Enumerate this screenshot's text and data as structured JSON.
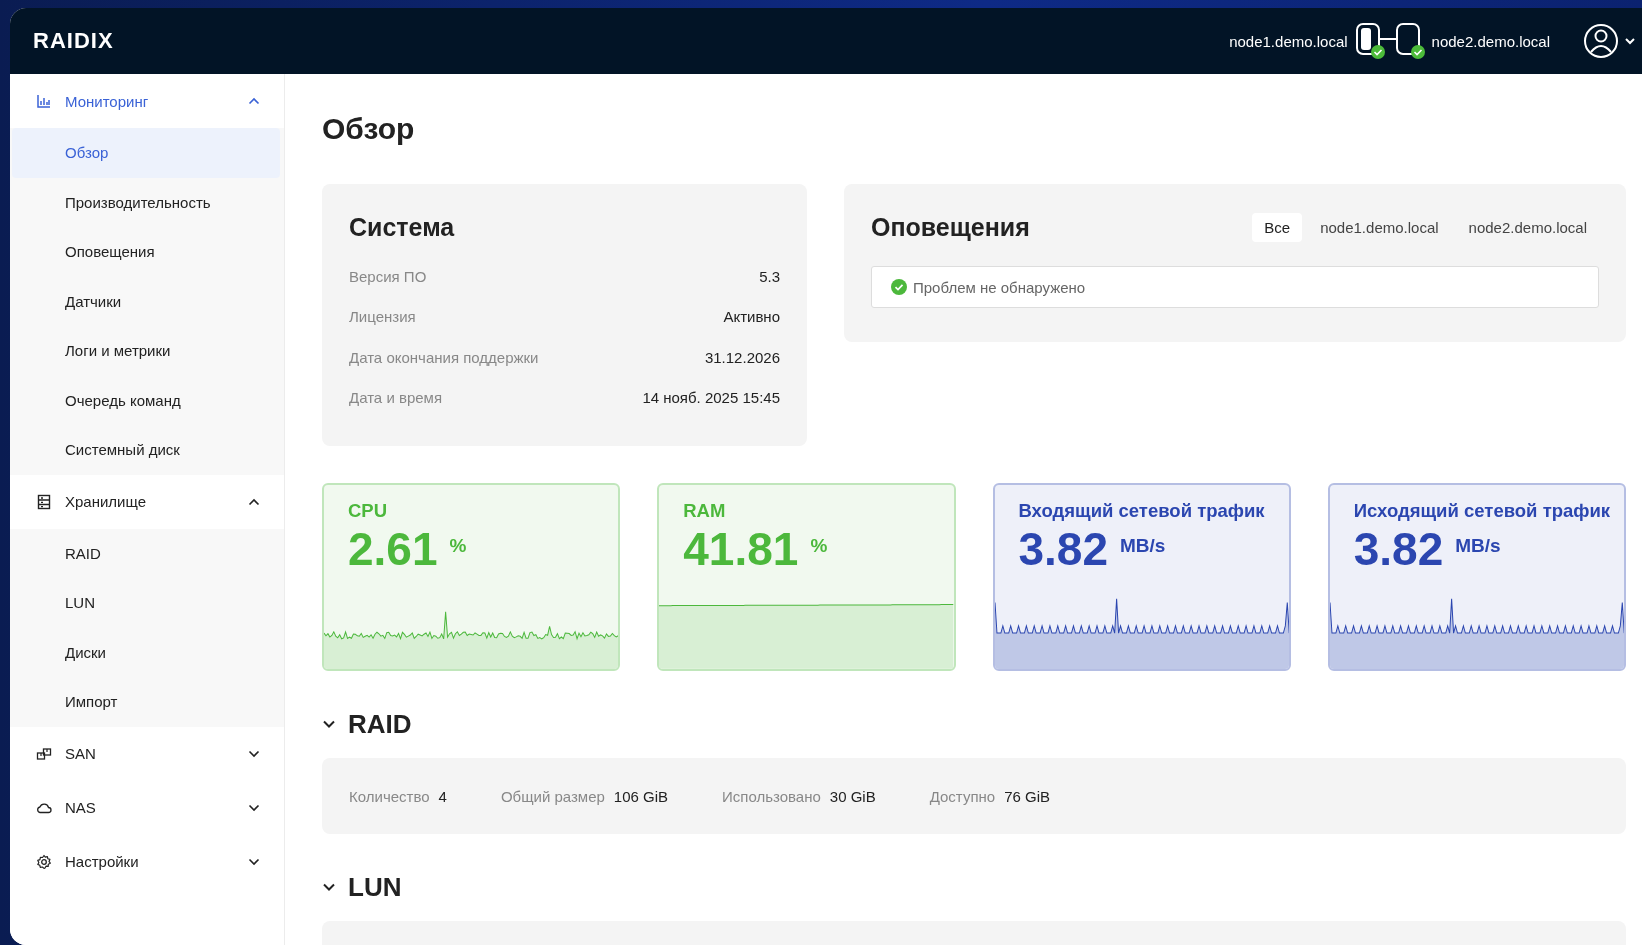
{
  "header": {
    "logo": "RAIDIX",
    "nodes": [
      {
        "name": "node1.demo.local",
        "ok": true
      },
      {
        "name": "node2.demo.local",
        "ok": true
      }
    ]
  },
  "sidebar": {
    "groups": [
      {
        "label": "Мониторинг",
        "expanded": true,
        "items": [
          {
            "label": "Обзор",
            "selected": true
          },
          {
            "label": "Производительность",
            "selected": false
          },
          {
            "label": "Оповещения",
            "selected": false
          },
          {
            "label": "Датчики",
            "selected": false
          },
          {
            "label": "Логи и метрики",
            "selected": false
          },
          {
            "label": "Очередь команд",
            "selected": false
          },
          {
            "label": "Системный диск",
            "selected": false
          }
        ]
      },
      {
        "label": "Хранилище",
        "expanded": true,
        "items": [
          {
            "label": "RAID",
            "selected": false
          },
          {
            "label": "LUN",
            "selected": false
          },
          {
            "label": "Диски",
            "selected": false
          },
          {
            "label": "Импорт",
            "selected": false
          }
        ]
      },
      {
        "label": "SAN",
        "expanded": false
      },
      {
        "label": "NAS",
        "expanded": false
      },
      {
        "label": "Настройки",
        "expanded": false
      }
    ]
  },
  "page_title": "Обзор",
  "system": {
    "title": "Система",
    "rows": [
      {
        "label": "Версия ПО",
        "value": "5.3"
      },
      {
        "label": "Лицензия",
        "value": "Активно"
      },
      {
        "label": "Дата окончания поддержки",
        "value": "31.12.2026"
      },
      {
        "label": "Дата и время",
        "value": "14 нояб. 2025 15:45"
      }
    ]
  },
  "alerts": {
    "title": "Оповещения",
    "tabs": [
      {
        "label": "Все",
        "selected": true
      },
      {
        "label": "node1.demo.local",
        "selected": false
      },
      {
        "label": "node2.demo.local",
        "selected": false
      }
    ],
    "message": "Проблем не обнаружено"
  },
  "metrics": [
    {
      "title": "CPU",
      "value": "2.61",
      "unit": "%",
      "color": "#4cb83c",
      "kind": "noise"
    },
    {
      "title": "RAM",
      "value": "41.81",
      "unit": "%",
      "color": "#4cb83c",
      "kind": "flat"
    },
    {
      "title": "Входящий сетевой трафик",
      "value": "3.82",
      "unit": "MB/s",
      "color": "#2b46b0",
      "kind": "spikes"
    },
    {
      "title": "Исходящий сетевой трафик",
      "value": "3.82",
      "unit": "MB/s",
      "color": "#2b46b0",
      "kind": "spikes"
    }
  ],
  "sections": [
    {
      "title": "RAID",
      "expanded": true,
      "stats": [
        {
          "label": "Количество",
          "value": "4"
        },
        {
          "label": "Общий размер",
          "value": "106 GiB"
        },
        {
          "label": "Использовано",
          "value": "30 GiB"
        },
        {
          "label": "Доступно",
          "value": "76 GiB"
        }
      ]
    },
    {
      "title": "LUN",
      "expanded": true
    }
  ]
}
